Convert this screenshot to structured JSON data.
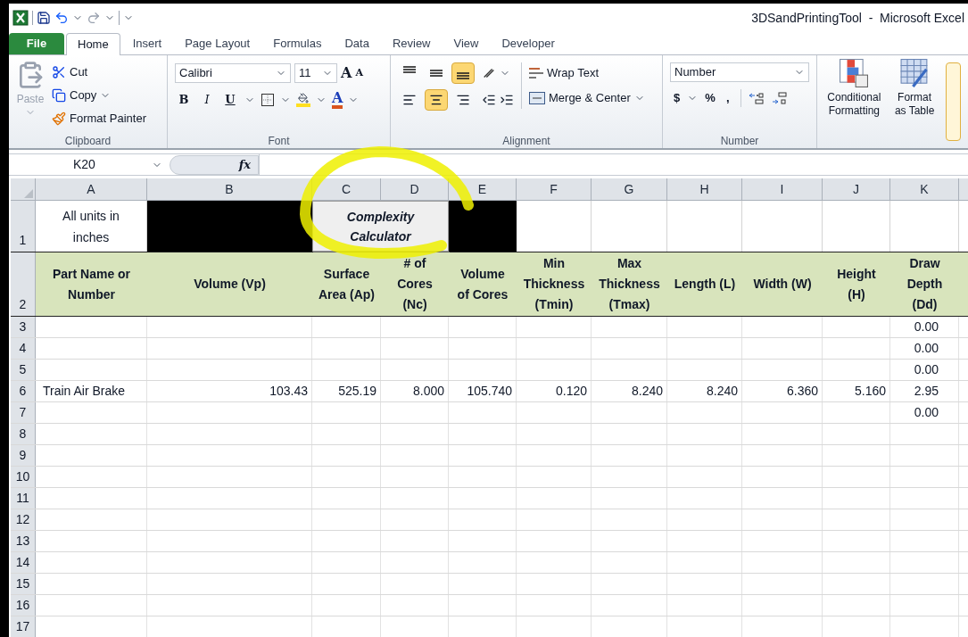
{
  "title_bar": {
    "title": "3DSandPrintingTool  -  Microsoft Excel"
  },
  "tabs": [
    {
      "label": "File",
      "kind": "file",
      "selected": false
    },
    {
      "label": "Home",
      "kind": "tab",
      "selected": true
    },
    {
      "label": "Insert",
      "kind": "tab",
      "selected": false
    },
    {
      "label": "Page Layout",
      "kind": "tab",
      "selected": false
    },
    {
      "label": "Formulas",
      "kind": "tab",
      "selected": false
    },
    {
      "label": "Data",
      "kind": "tab",
      "selected": false
    },
    {
      "label": "Review",
      "kind": "tab",
      "selected": false
    },
    {
      "label": "View",
      "kind": "tab",
      "selected": false
    },
    {
      "label": "Developer",
      "kind": "tab",
      "selected": false
    }
  ],
  "clipboard": {
    "paste": {
      "label": "Paste",
      "disabled": true
    },
    "cut": "Cut",
    "copy": "Copy",
    "format_painter": "Format Painter",
    "label": "Clipboard"
  },
  "font": {
    "name": "Calibri",
    "size": "11",
    "grow": "A",
    "shrink": "A",
    "bold": "B",
    "italic": "I",
    "underline": "U",
    "color_glyph": "A",
    "label": "Font"
  },
  "alignment": {
    "vertical": [
      {
        "kind": "top",
        "selected": false
      },
      {
        "kind": "middle",
        "selected": false
      },
      {
        "kind": "bottom",
        "selected": true
      }
    ],
    "horizontal": [
      {
        "kind": "left",
        "selected": false
      },
      {
        "kind": "center",
        "selected": true
      },
      {
        "kind": "right",
        "selected": false
      }
    ],
    "wrap_text": "Wrap Text",
    "merge_center": "Merge & Center",
    "label": "Alignment"
  },
  "number": {
    "format": "Number",
    "currency": "$",
    "percent": "%",
    "comma": ",",
    "label": "Number"
  },
  "styles": {
    "conditional_formatting": "Conditional Formatting",
    "format_as_table": "Format as Table"
  },
  "formula_bar": {
    "name_box": "K20",
    "fx": "fx"
  },
  "sheet": {
    "columns": [
      "A",
      "B",
      "C",
      "D",
      "E",
      "F",
      "G",
      "H",
      "I",
      "J",
      "K"
    ],
    "row1": {
      "number": "1",
      "cells": [
        {
          "kind": "text",
          "text": "All units in inches"
        },
        {
          "kind": "black"
        },
        {
          "kind": "button",
          "text": "Complexity Calculator"
        },
        {
          "kind": "black"
        },
        {
          "kind": "empty"
        },
        {
          "kind": "empty"
        },
        {
          "kind": "empty"
        },
        {
          "kind": "empty"
        },
        {
          "kind": "empty"
        },
        {
          "kind": "empty"
        }
      ]
    },
    "header_row": {
      "number": "2",
      "cells": [
        "Part Name or Number",
        "Volume (Vp)",
        "Surface Area (Ap)",
        "# of Cores (Nc)",
        "Volume of Cores",
        "Min Thickness (Tmin)",
        "Max Thickness (Tmax)",
        "Length (L)",
        "Width (W)",
        "Height (H)",
        "Draw Depth (Dd)"
      ]
    },
    "rows": [
      {
        "number": "3",
        "cells": {
          "K": "0.00"
        }
      },
      {
        "number": "4",
        "cells": {
          "K": "0.00"
        }
      },
      {
        "number": "5",
        "cells": {
          "K": "0.00"
        }
      },
      {
        "number": "6",
        "cells": {
          "A": "Train Air Brake",
          "B": "103.43",
          "C": "525.19",
          "D": "8.000",
          "E": "105.740",
          "F": "0.120",
          "G": "8.240",
          "H": "8.240",
          "I": "6.360",
          "J": "5.160",
          "K": "2.95"
        }
      },
      {
        "number": "7",
        "cells": {
          "K": "0.00"
        }
      },
      {
        "number": "8"
      },
      {
        "number": "9"
      },
      {
        "number": "10"
      },
      {
        "number": "11"
      },
      {
        "number": "12"
      },
      {
        "number": "13"
      },
      {
        "number": "14"
      },
      {
        "number": "15"
      },
      {
        "number": "16"
      },
      {
        "number": "17"
      }
    ]
  }
}
